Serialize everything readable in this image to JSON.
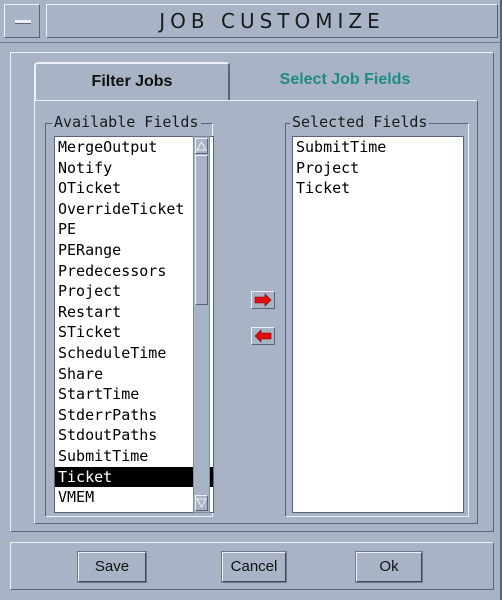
{
  "window": {
    "title": "JOB CUSTOMIZE",
    "menu_icon": "window-menu-icon"
  },
  "tabs": [
    {
      "label": "Filter Jobs",
      "active": false,
      "color": "#101010"
    },
    {
      "label": "Select Job Fields",
      "active": true,
      "color": "#1f8a86"
    }
  ],
  "available_fields": {
    "label": "Available Fields",
    "items": [
      "MergeOutput",
      "Notify",
      "OTicket",
      "OverrideTicket",
      "PE",
      "PERange",
      "Predecessors",
      "Project",
      "Restart",
      "STicket",
      "ScheduleTime",
      "Share",
      "StartTime",
      "StderrPaths",
      "StdoutPaths",
      "SubmitTime",
      "Ticket",
      "VMEM"
    ],
    "selected_item": "Ticket"
  },
  "selected_fields": {
    "label": "Selected Fields",
    "items": [
      "SubmitTime",
      "Project",
      "Ticket"
    ]
  },
  "transfer": {
    "add_icon": "arrow-right-icon",
    "remove_icon": "arrow-left-icon",
    "arrow_color": "#e01010"
  },
  "buttons": {
    "save": "Save",
    "cancel": "Cancel",
    "ok": "Ok"
  },
  "colors": {
    "background": "#a8b4c6",
    "list_background": "#ffffff",
    "selection": "#000000",
    "active_tab_text": "#1f8a86"
  }
}
